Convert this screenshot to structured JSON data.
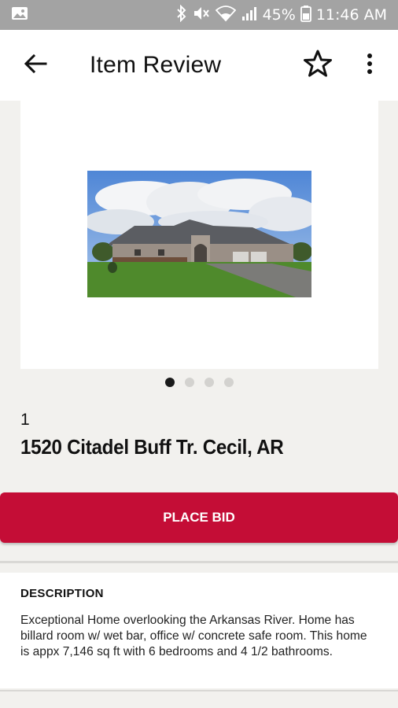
{
  "status_bar": {
    "battery": "45%",
    "time": "11:46 AM",
    "icons": [
      "image-icon",
      "bluetooth-icon",
      "mute-icon",
      "wifi-icon",
      "signal-icon",
      "battery-icon"
    ]
  },
  "app_bar": {
    "title": "Item Review",
    "back_icon": "arrow-back-icon",
    "favorite_icon": "star-outline-icon",
    "menu_icon": "more-vert-icon"
  },
  "gallery": {
    "image": "house-photo",
    "page_count": 4,
    "active_page": 1
  },
  "item": {
    "lot_number": "1",
    "title": "1520 Citadel Buff Tr. Cecil, AR"
  },
  "actions": {
    "bid_label": "PLACE BID",
    "bid_color": "#c40d36"
  },
  "description": {
    "heading": "DESCRIPTION",
    "text": "Exceptional Home overlooking the Arkansas River. Home has billard room w/ wet bar, office w/ concrete safe room. This home is appx 7,146 sq ft with 6 bedrooms and 4 1/2 bathrooms."
  }
}
